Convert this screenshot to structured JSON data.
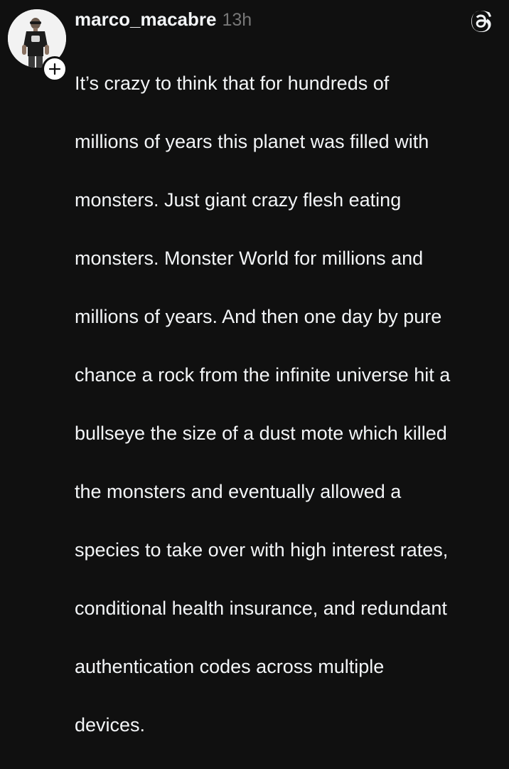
{
  "post": {
    "username": "marco_macabre",
    "timestamp": "13h",
    "lines": [
      "It’s crazy to think that for hundreds of",
      "millions of years this planet was filled with",
      "monsters. Just giant crazy flesh eating",
      "monsters. Monster World for millions and",
      "millions of years. And then one day by pure",
      "chance a rock from the infinite universe hit a",
      "bullseye the size of a dust mote which killed",
      "the monsters and eventually allowed a",
      "species to take over with high interest rates,",
      "conditional health insurance, and redundant",
      "authentication codes across multiple",
      "devices."
    ]
  },
  "icons": {
    "follow": "plus-icon",
    "app": "threads-logo-icon"
  },
  "colors": {
    "background": "#101010",
    "text": "#f3f5f7",
    "muted": "#777777"
  }
}
